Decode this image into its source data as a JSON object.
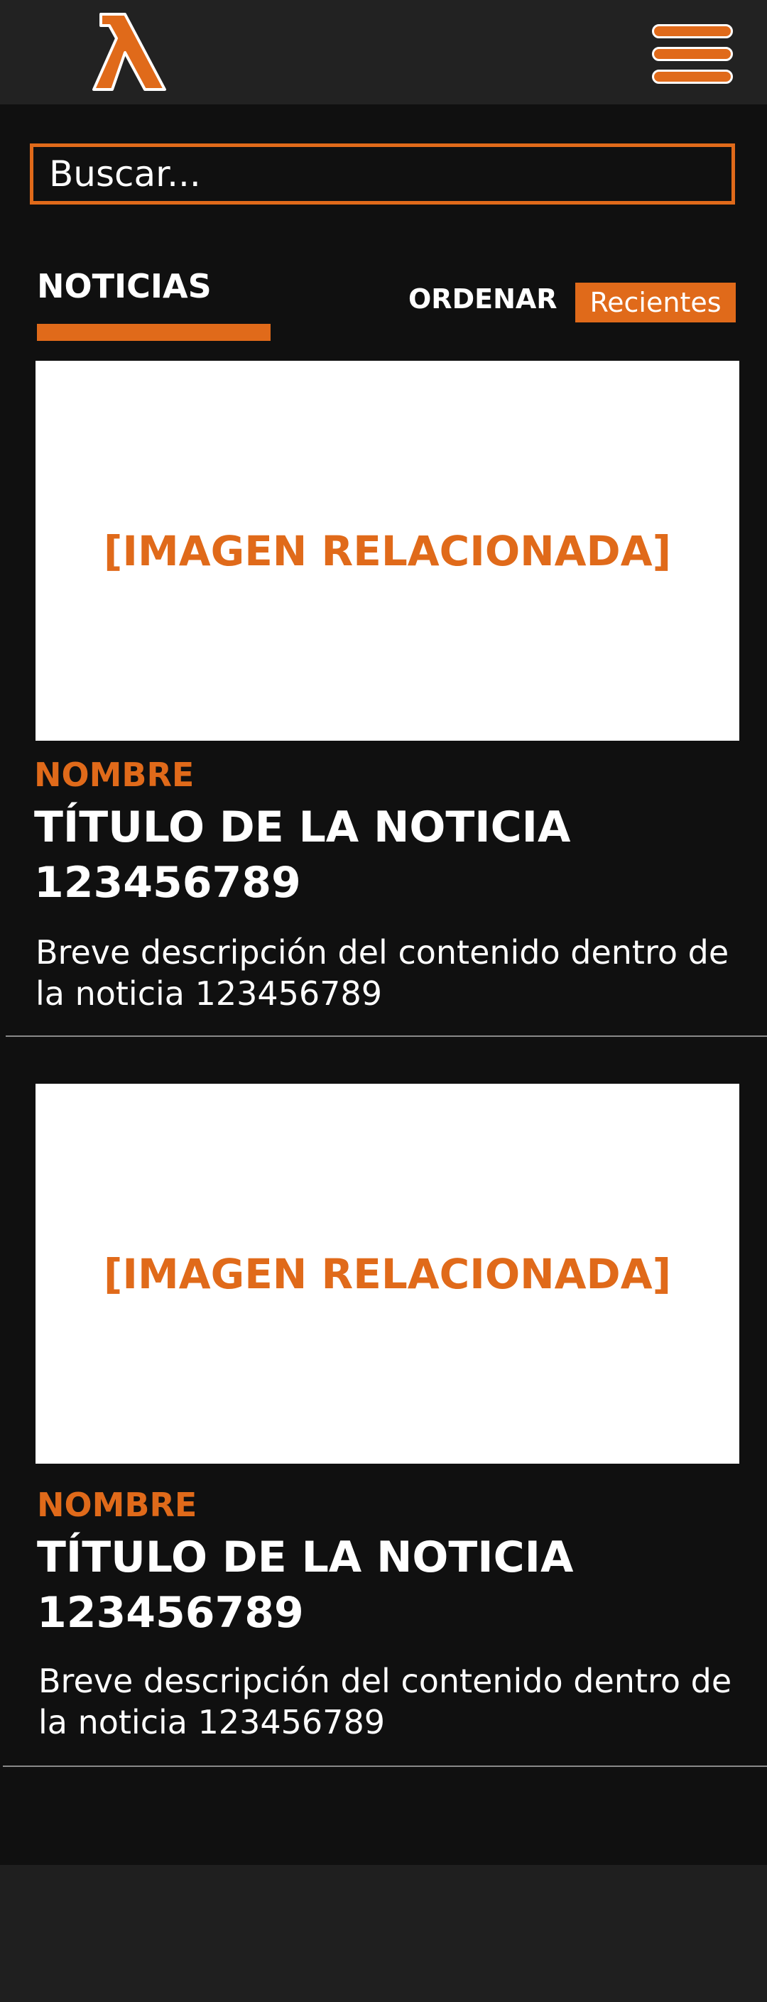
{
  "colors": {
    "accent": "#e06a1a",
    "background": "#101010",
    "header": "#222222",
    "footer": "#1f1f1f"
  },
  "header": {
    "logo_icon": "lambda-logo-icon",
    "menu_icon": "hamburger-menu-icon"
  },
  "search": {
    "placeholder": "Buscar..."
  },
  "tabs": {
    "active": "NOTICIAS"
  },
  "sort": {
    "label": "ORDENAR",
    "selected": "Recientes"
  },
  "news": [
    {
      "image_text": "[IMAGEN RELACIONADA]",
      "category": "NOMBRE",
      "title": "TÍTULO DE LA NOTICIA 123456789",
      "description": "Breve descripción del contenido dentro de la noticia 123456789"
    },
    {
      "image_text": "[IMAGEN RELACIONADA]",
      "category": "NOMBRE",
      "title": "TÍTULO DE LA NOTICIA 123456789",
      "description": "Breve descripción del contenido dentro de la noticia 123456789"
    }
  ]
}
